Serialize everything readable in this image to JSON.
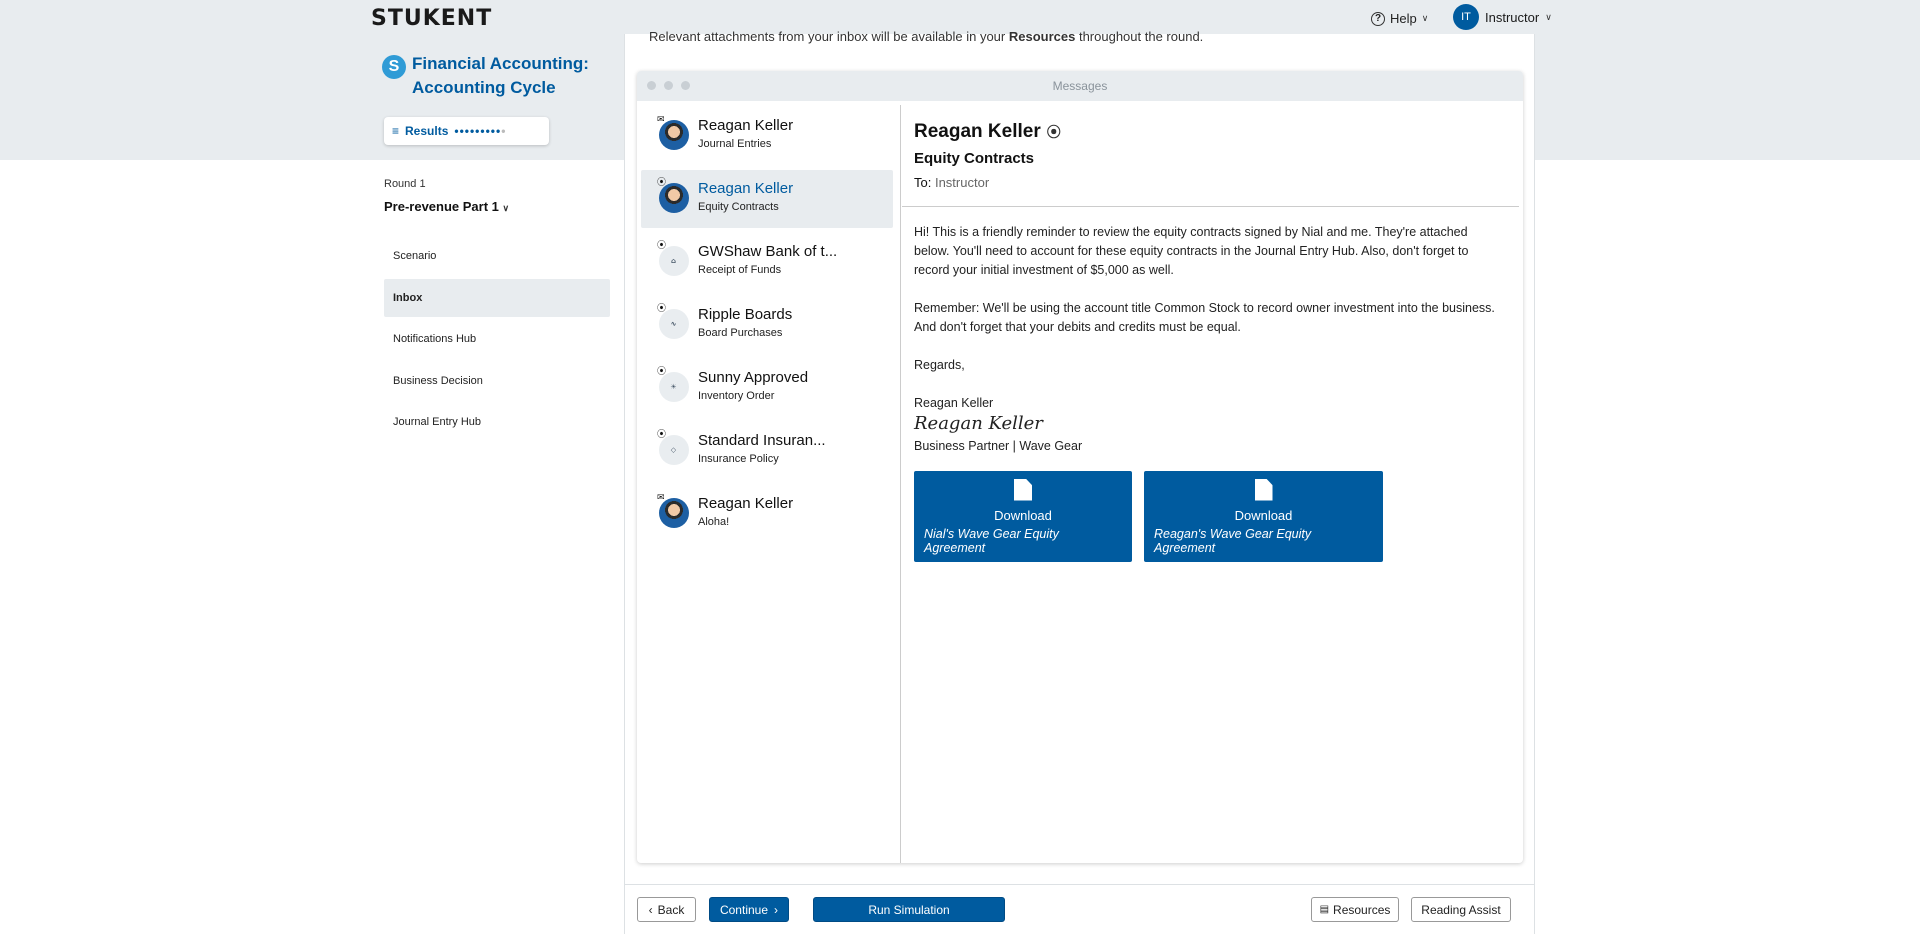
{
  "header": {
    "logo": "STUKENT",
    "help_label": "Help",
    "user_initials": "IT",
    "user_name": "Instructor"
  },
  "course": {
    "logo_letter": "S",
    "title": "Financial Accounting: Accounting Cycle",
    "results_label": "Results"
  },
  "round": {
    "label": "Round 1",
    "part": "Pre-revenue Part 1"
  },
  "nav": [
    {
      "label": "Scenario"
    },
    {
      "label": "Inbox"
    },
    {
      "label": "Notifications Hub"
    },
    {
      "label": "Business Decision"
    },
    {
      "label": "Journal Entry Hub"
    }
  ],
  "top_note": {
    "before": "Relevant attachments from your inbox will be available in your",
    "bold": "Resources",
    "after": "throughout the round."
  },
  "messages_title": "Messages",
  "inbox": [
    {
      "sender": "Reagan Keller",
      "subject": "Journal Entries",
      "icon": "envelope-icon",
      "avatar": "person"
    },
    {
      "sender": "Reagan Keller",
      "subject": "Equity Contracts",
      "icon": "paperclip-icon",
      "avatar": "person"
    },
    {
      "sender": "GWShaw Bank of t...",
      "subject": "Receipt of Funds",
      "icon": "paperclip-icon",
      "avatar": "logo"
    },
    {
      "sender": "Ripple Boards",
      "subject": "Board Purchases",
      "icon": "paperclip-icon",
      "avatar": "logo"
    },
    {
      "sender": "Sunny Approved",
      "subject": "Inventory Order",
      "icon": "paperclip-icon",
      "avatar": "logo"
    },
    {
      "sender": "Standard Insuran...",
      "subject": "Insurance Policy",
      "icon": "paperclip-icon",
      "avatar": "logo"
    },
    {
      "sender": "Reagan Keller",
      "subject": "Aloha!",
      "icon": "envelope-icon",
      "avatar": "person"
    }
  ],
  "reader": {
    "sender": "Reagan Keller",
    "subject": "Equity Contracts",
    "to_label": "To:",
    "to_value": "Instructor",
    "p1": "Hi! This is a friendly reminder to review the equity contracts signed by Nial and me. They're attached below. You'll need to account for these equity contracts in the Journal Entry Hub. Also, don't forget to record your initial investment of $5,000 as well.",
    "p2": "Remember: We'll be using the account title Common Stock to record owner investment into the business. And don't forget that your debits and credits must be equal.",
    "p3": "Regards,",
    "sign_name": "Reagan Keller",
    "signature": "Reagan Keller",
    "sign_title": "Business Partner | Wave Gear",
    "downloads": [
      {
        "label": "Download",
        "file": "Nial's Wave Gear Equity Agreement"
      },
      {
        "label": "Download",
        "file": "Reagan's Wave Gear Equity Agreement"
      }
    ]
  },
  "footer": {
    "back": "Back",
    "continue": "Continue",
    "run": "Run Simulation",
    "resources": "Resources",
    "reading": "Reading Assist"
  },
  "colors": {
    "brand": "#005b9f",
    "band": "#e8ecef"
  }
}
